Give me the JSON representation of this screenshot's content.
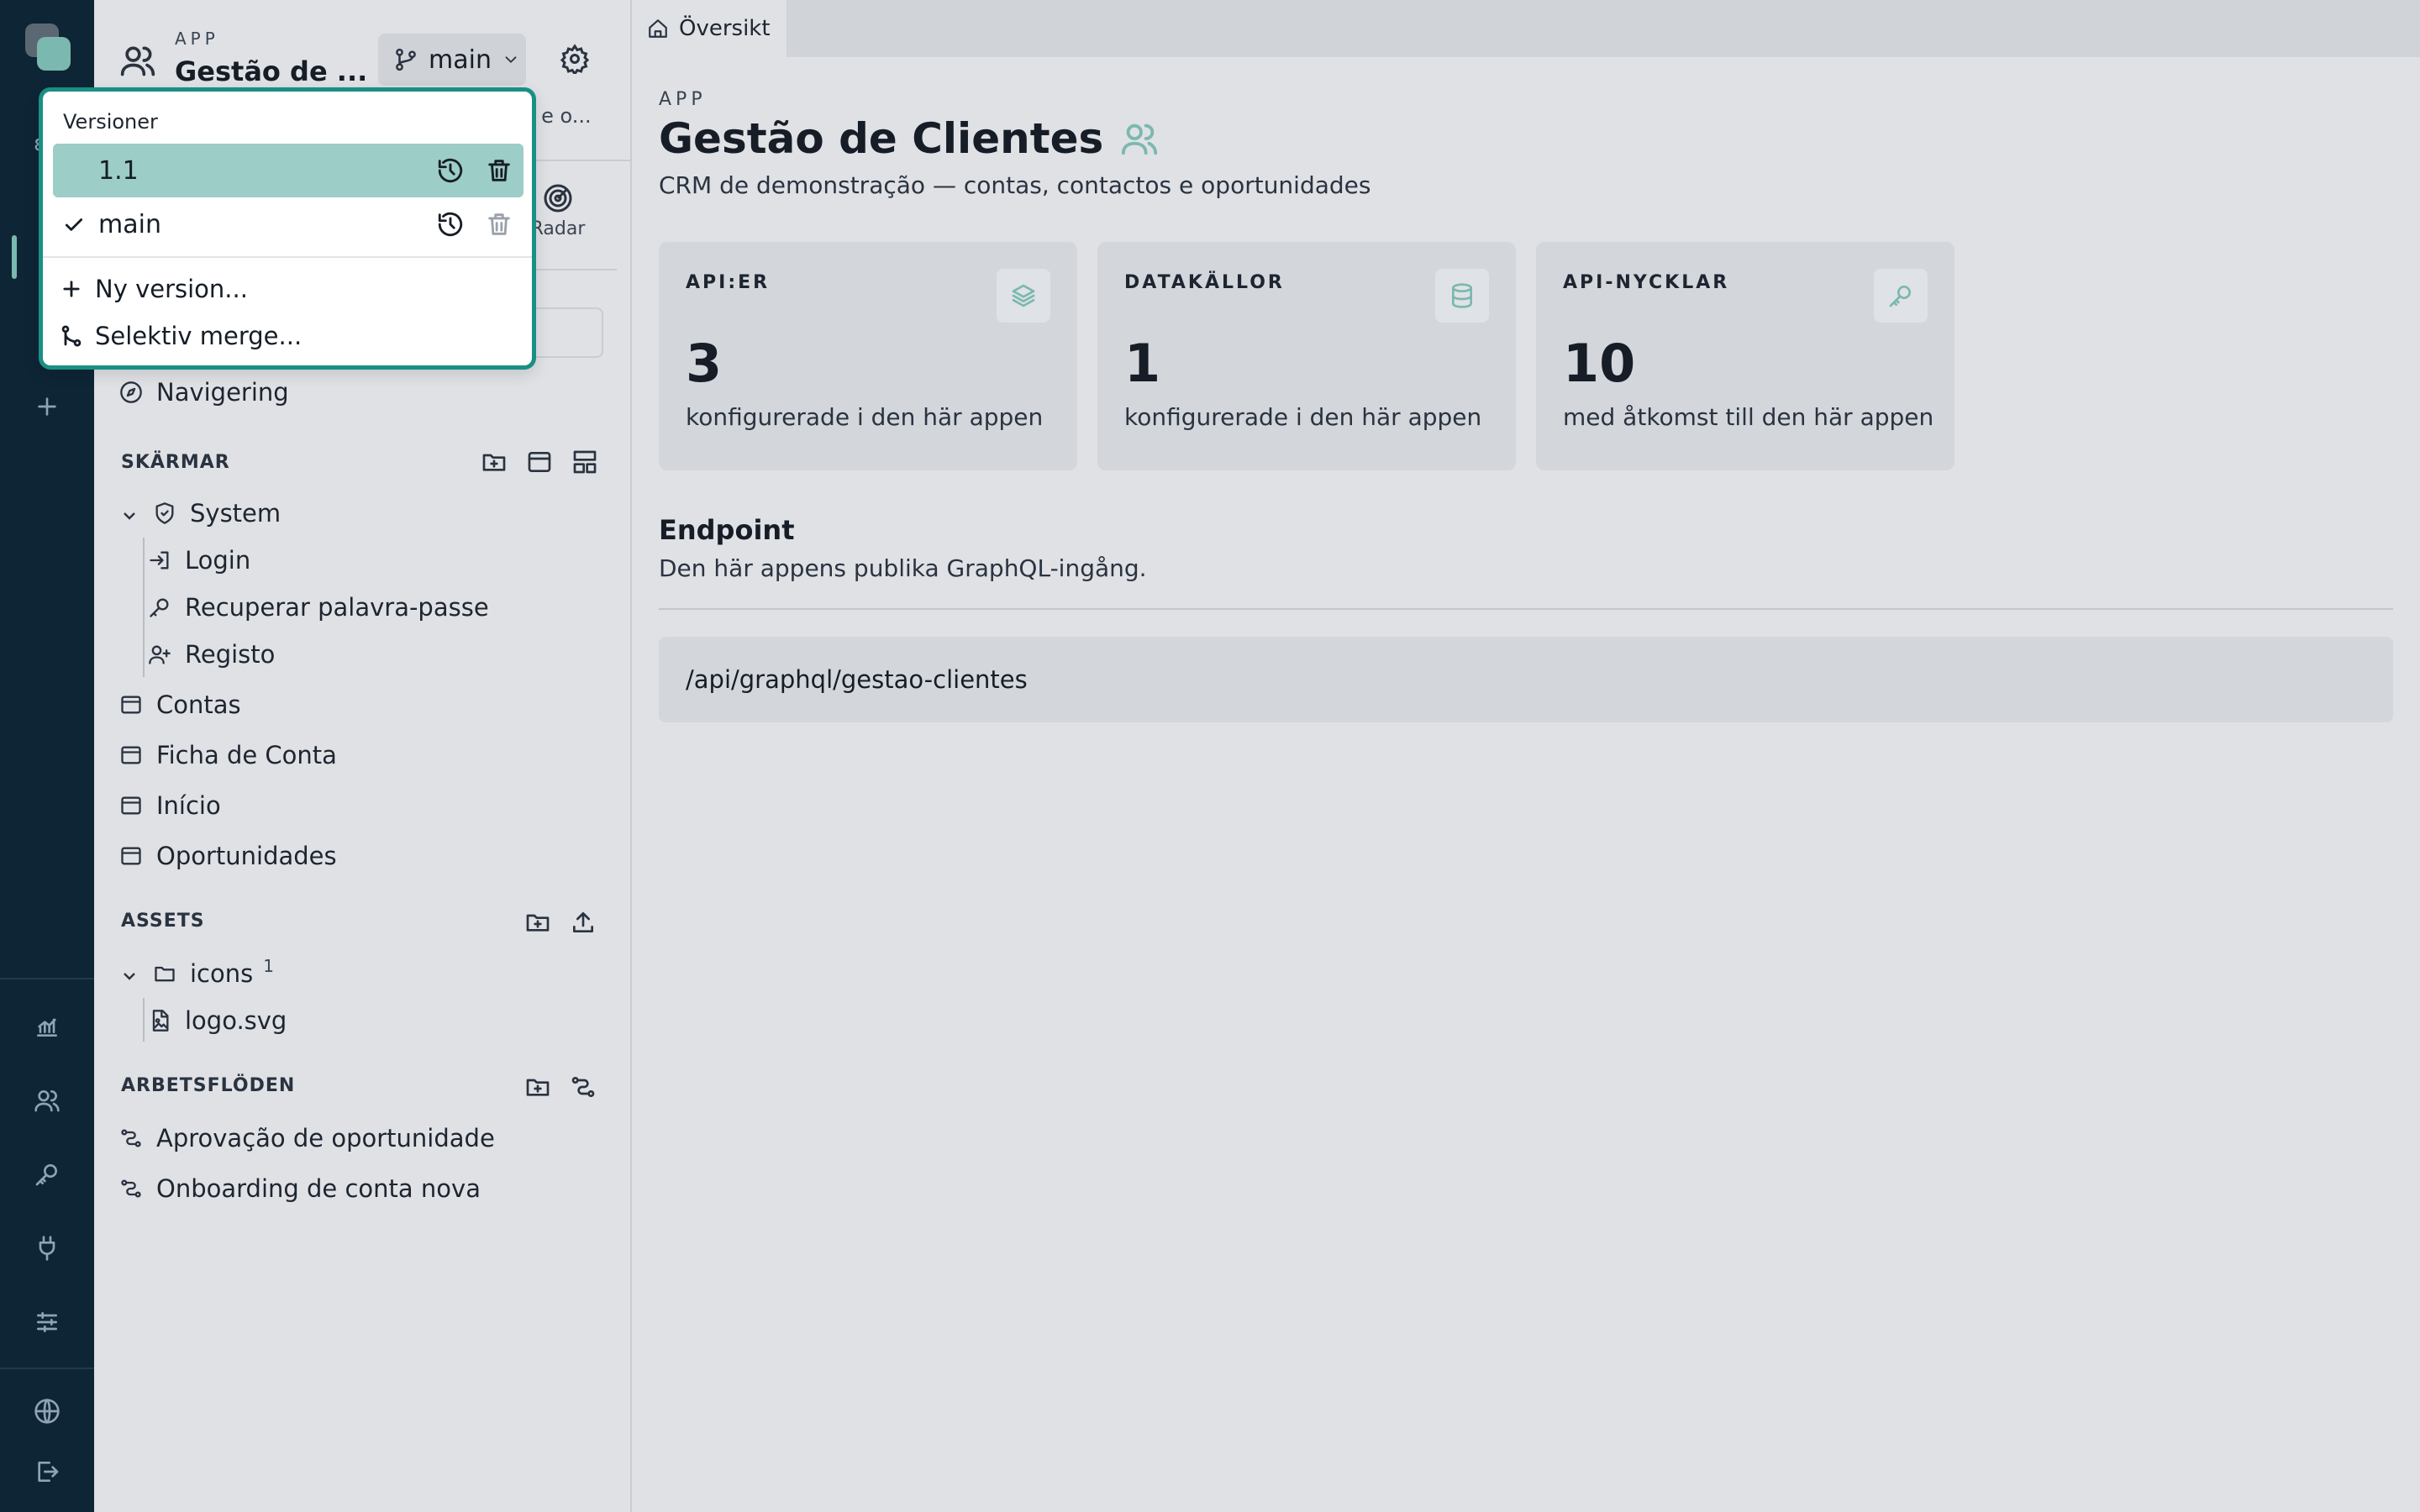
{
  "sidebar": {
    "app_label": "APP",
    "app_name": "Gestão de ...",
    "branch": "main",
    "subtitle_peek": "s e o...",
    "radar_label": "Radar",
    "nav_item": "Navigering",
    "sections": {
      "screens": "SKÄRMAR",
      "assets": "ASSETS",
      "workflows": "ARBETSFLÖDEN"
    },
    "screens": {
      "system_folder": "System",
      "system_children": [
        "Login",
        "Recuperar palavra-passe",
        "Registo"
      ],
      "items": [
        "Contas",
        "Ficha de Conta",
        "Início",
        "Oportunidades"
      ]
    },
    "assets": {
      "folder": "icons",
      "folder_count": "1",
      "file": "logo.svg"
    },
    "workflows": [
      "Aprovação de oportunidade",
      "Onboarding de conta nova"
    ]
  },
  "tab": {
    "label": "Översikt"
  },
  "main": {
    "app_label": "APP",
    "title": "Gestão de Clientes",
    "description": "CRM de demonstração — contas, contactos e oportunidades",
    "cards": [
      {
        "label": "API:ER",
        "value": "3",
        "sub": "konfigurerade i den här appen",
        "icon": "layers-icon"
      },
      {
        "label": "DATAKÄLLOR",
        "value": "1",
        "sub": "konfigurerade i den här appen",
        "icon": "database-icon"
      },
      {
        "label": "API-NYCKLAR",
        "value": "10",
        "sub": "med åtkomst till den här appen",
        "icon": "key-icon"
      }
    ],
    "endpoint": {
      "title": "Endpoint",
      "description": "Den här appens publika GraphQL-ingång.",
      "path": "/api/graphql/gestao-clientes"
    }
  },
  "versions_popup": {
    "title": "Versioner",
    "versions": [
      {
        "name": "1.1",
        "selected": false,
        "highlighted": true
      },
      {
        "name": "main",
        "selected": true,
        "highlighted": false
      }
    ],
    "actions": [
      "Ny version...",
      "Selektiv merge..."
    ]
  },
  "colors": {
    "rail": "#0e2535",
    "accent": "#7bb8af",
    "popup_border": "#1a8f84",
    "highlight": "#9ccdc6",
    "background": "#dfe1e5"
  }
}
